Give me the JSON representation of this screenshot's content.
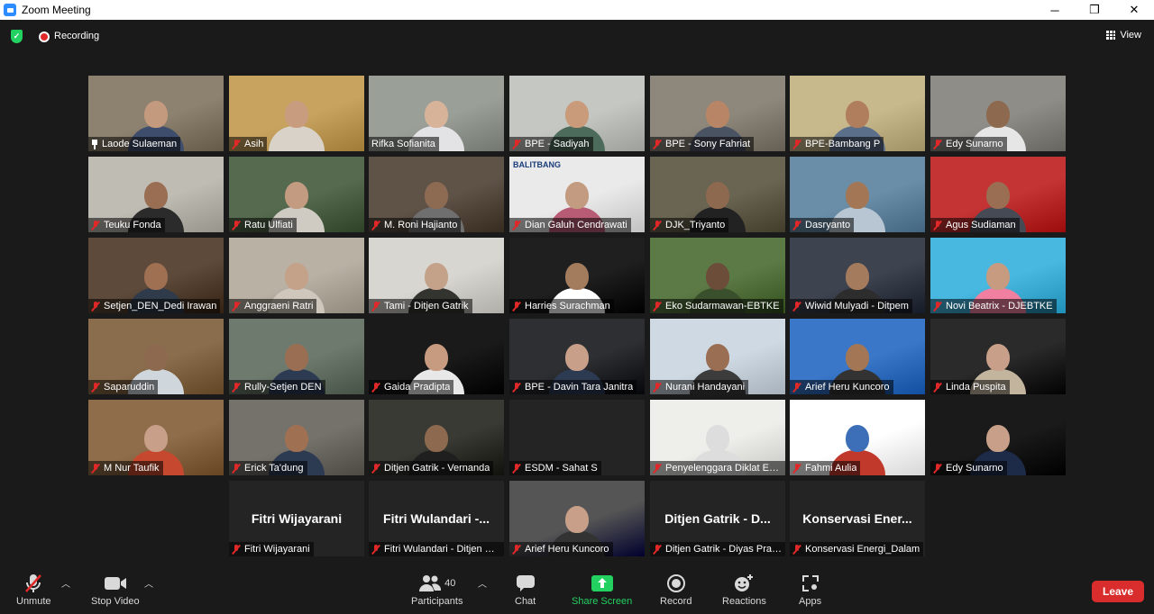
{
  "window": {
    "title": "Zoom Meeting",
    "minimize": "─",
    "restore": "❐",
    "close": "✕"
  },
  "topbar": {
    "recording_label": "Recording",
    "view_label": "View"
  },
  "tiles": [
    {
      "name": "Laode Sulaeman",
      "pinned": true
    },
    {
      "name": "Asih"
    },
    {
      "name": "Rifka Sofianita",
      "active": true
    },
    {
      "name": "BPE - Sadiyah"
    },
    {
      "name": "BPE - Sony Fahriat"
    },
    {
      "name": "BPE-Bambang P"
    },
    {
      "name": "Edy Sunarno"
    },
    {
      "name": "Teuku Fonda"
    },
    {
      "name": "Ratu Ulfiati"
    },
    {
      "name": "M. Roni Hajianto"
    },
    {
      "name": "Dian Galuh Cendrawati",
      "slide_text": "BALITBANG"
    },
    {
      "name": "DJK_Triyanto"
    },
    {
      "name": "Dasryanto"
    },
    {
      "name": "Agus Sudiaman"
    },
    {
      "name": "Setjen_DEN_Dedi Irawan"
    },
    {
      "name": "Anggraeni Ratri"
    },
    {
      "name": "Tami - Ditjen Gatrik"
    },
    {
      "name": "Harries Surachman"
    },
    {
      "name": "Eko Sudarmawan-EBTKE"
    },
    {
      "name": "Wiwid Mulyadi - Ditpem"
    },
    {
      "name": "Novi Beatrix - DJEBTKE"
    },
    {
      "name": "Saparuddin"
    },
    {
      "name": "Rully-Setjen DEN"
    },
    {
      "name": "Gaida Pradipta"
    },
    {
      "name": "BPE - Davin Tara Janitra"
    },
    {
      "name": "Nurani Handayani"
    },
    {
      "name": "Arief Heru Kuncoro"
    },
    {
      "name": "Linda Puspita"
    },
    {
      "name": "M Nur Taufik"
    },
    {
      "name": "Erick Ta'dung"
    },
    {
      "name": "Ditjen Gatrik - Vernanda"
    },
    {
      "name": "ESDM - Sahat S"
    },
    {
      "name": "Penyelenggara Diklat EBTKE"
    },
    {
      "name": "Fahmi Aulia"
    },
    {
      "name": "Edy Sunarno"
    },
    {
      "name": "Fitri Wijayarani",
      "big_name": "Fitri Wijayarani"
    },
    {
      "name": "Fitri Wulandari - Ditjen Gatrik",
      "big_name": "Fitri Wulandari -..."
    },
    {
      "name": "Arief Heru Kuncoro"
    },
    {
      "name": "Ditjen Gatrik - Diyas Pratama",
      "big_name": "Ditjen Gatrik - D..."
    },
    {
      "name": "Konservasi Energi_Dalam",
      "big_name": "Konservasi Ener..."
    }
  ],
  "toolbar": {
    "unmute": "Unmute",
    "stop_video": "Stop Video",
    "participants": "Participants",
    "participants_count": "40",
    "chat": "Chat",
    "share_screen": "Share Screen",
    "record": "Record",
    "reactions": "Reactions",
    "apps": "Apps",
    "leave": "Leave"
  },
  "colors": {
    "share_green": "#23d160",
    "leave_red": "#d92d2d",
    "active_speaker": "#b8e04a",
    "muted_red": "#e02828"
  }
}
